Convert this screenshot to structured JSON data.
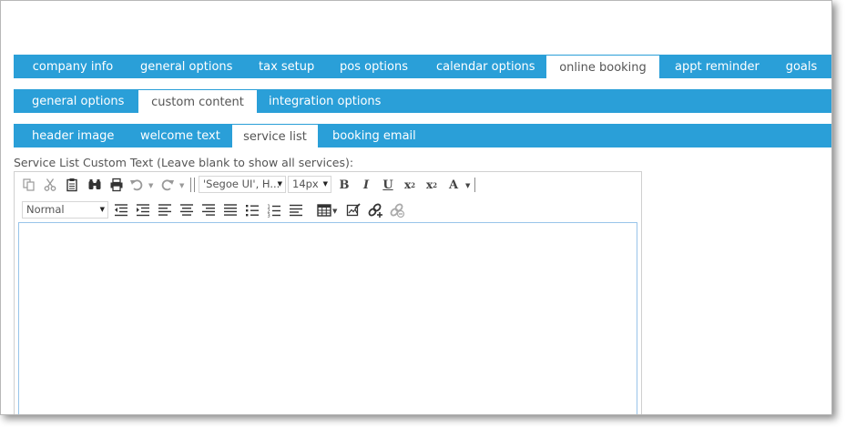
{
  "tabs_main": [
    {
      "label": "company info",
      "active": false
    },
    {
      "label": "general options",
      "active": false
    },
    {
      "label": "tax setup",
      "active": false
    },
    {
      "label": "pos options",
      "active": false
    },
    {
      "label": "calendar options",
      "active": false
    },
    {
      "label": "online booking",
      "active": true
    },
    {
      "label": "appt reminder",
      "active": false
    },
    {
      "label": "goals",
      "active": false
    }
  ],
  "tabs_booking": [
    {
      "label": "general options",
      "active": false
    },
    {
      "label": "custom content",
      "active": true
    },
    {
      "label": "integration options",
      "active": false
    }
  ],
  "tabs_content": [
    {
      "label": "header image",
      "active": false
    },
    {
      "label": "welcome text",
      "active": false
    },
    {
      "label": "service list",
      "active": true
    },
    {
      "label": "booking email",
      "active": false
    }
  ],
  "field_label": "Service List Custom Text (Leave blank to show all services):",
  "editor": {
    "font_family_value": "'Segoe UI', H...",
    "font_size_value": "14px",
    "paragraph_format_value": "Normal",
    "content": ""
  },
  "colors": {
    "tab_bar": "#2a9fd8",
    "active_tab_bg": "#ffffff",
    "editor_focus_border": "#98c4ea"
  }
}
